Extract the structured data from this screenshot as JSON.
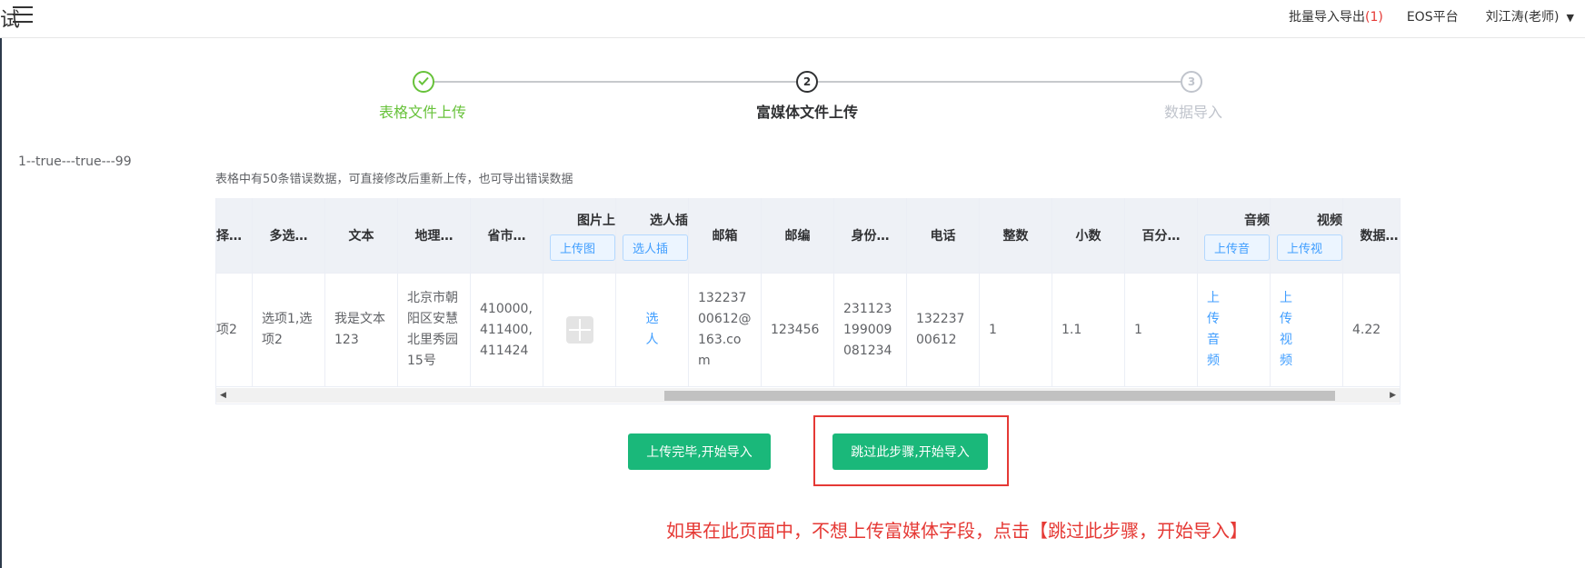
{
  "header": {
    "brand_fragment": "试",
    "batch_label": "批量导入导出",
    "batch_count": "(1)",
    "eos_label": "EOS平台",
    "user_label": "刘江涛(老师)"
  },
  "steps": [
    {
      "title": "表格文件上传",
      "index": "1",
      "status": "done"
    },
    {
      "title": "富媒体文件上传",
      "index": "2",
      "status": "active"
    },
    {
      "title": "数据导入",
      "index": "3",
      "status": "wait"
    }
  ],
  "debug_text": "1--true---true---99",
  "notice": "表格中有50条错误数据，可直接修改后重新上传，也可导出错误数据",
  "table": {
    "headers": {
      "single": "择…",
      "multi": "多选…",
      "text": "文本",
      "geo": "地理…",
      "region": "省市…",
      "image": "图片上",
      "image_btn": "上传图",
      "person": "选人插",
      "person_btn": "选人插",
      "email": "邮箱",
      "zip": "邮编",
      "idcard": "身份…",
      "phone": "电话",
      "int": "整数",
      "decimal": "小数",
      "percent": "百分…",
      "audio": "音频",
      "audio_btn": "上传音",
      "video": "视频",
      "video_btn": "上传视",
      "data": "数据…"
    },
    "row": {
      "single": "项2",
      "multi": "选项1,选项2",
      "text": "我是文本123",
      "geo": "北京市朝阳区安慧北里秀园15号",
      "region": "410000,411400,411424",
      "person": "选人",
      "email": "13223700612@163.com",
      "zip": "123456",
      "idcard": "231123199009081234",
      "phone": "13223700612",
      "int": "1",
      "decimal": "1.1",
      "percent": "1",
      "audio_chars": [
        "上",
        "传",
        "音",
        "频"
      ],
      "video_chars": [
        "上",
        "传",
        "视",
        "频"
      ],
      "data": "4.22"
    },
    "scroll_fraction": 0.67
  },
  "buttons": {
    "upload_done": "上传完毕,开始导入",
    "skip": "跳过此步骤,开始导入"
  },
  "hint": "如果在此页面中，不想上传富媒体字段，点击【跳过此步骤，开始导入】",
  "colors": {
    "primary_green": "#1ab87a",
    "step_done": "#67c23a",
    "annotation_red": "#e53935",
    "link_blue": "#409eff"
  }
}
